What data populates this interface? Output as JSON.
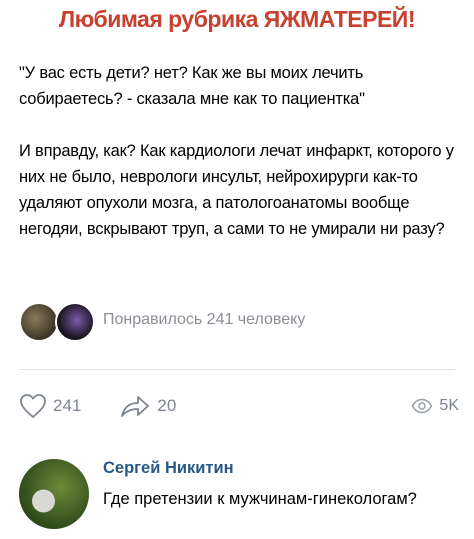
{
  "header": {
    "title": "Любимая рубрика ЯЖМАТЕРЕЙ!",
    "title_color": "#c8412f"
  },
  "post": {
    "paragraph1": "\"У вас есть дети? нет? Как же вы моих лечить собираетесь? - сказала мне как то пациентка\"",
    "paragraph2": "И вправду, как? Как кардиологи лечат инфаркт, которого у них не было, неврологи инсульт, нейрохирурги как-то удаляют опухоли мозга, а патологоанатомы вообще негодяи, вскрывают труп, а сами то не умирали ни разу?"
  },
  "likes": {
    "text": "Понравилось 241 человеку"
  },
  "actions": {
    "like_icon": "heart-outline-icon",
    "like_count": "241",
    "share_icon": "share-arrow-icon",
    "share_count": "20",
    "views_icon": "eye-icon",
    "views_count": "5K"
  },
  "comment": {
    "author": "Сергей Никитин",
    "text": "Где претензии к мужчинам-гинекологам?",
    "author_color": "#2a5885"
  }
}
